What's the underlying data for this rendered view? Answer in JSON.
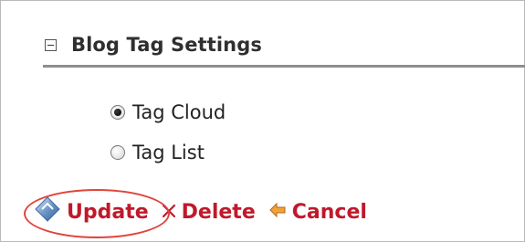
{
  "panel": {
    "title": "Blog Tag Settings"
  },
  "options": [
    {
      "label": "Tag Cloud",
      "checked": true
    },
    {
      "label": "Tag List",
      "checked": false
    }
  ],
  "actions": {
    "update": "Update",
    "delete": "Delete",
    "cancel": "Cancel"
  },
  "colors": {
    "action_text": "#c0192b",
    "highlight": "#e0443e",
    "rule": "#8e8e8e"
  },
  "icons": {
    "update": "diamond-update-icon",
    "delete": "delete-x-icon",
    "cancel": "cancel-arrow-icon"
  }
}
